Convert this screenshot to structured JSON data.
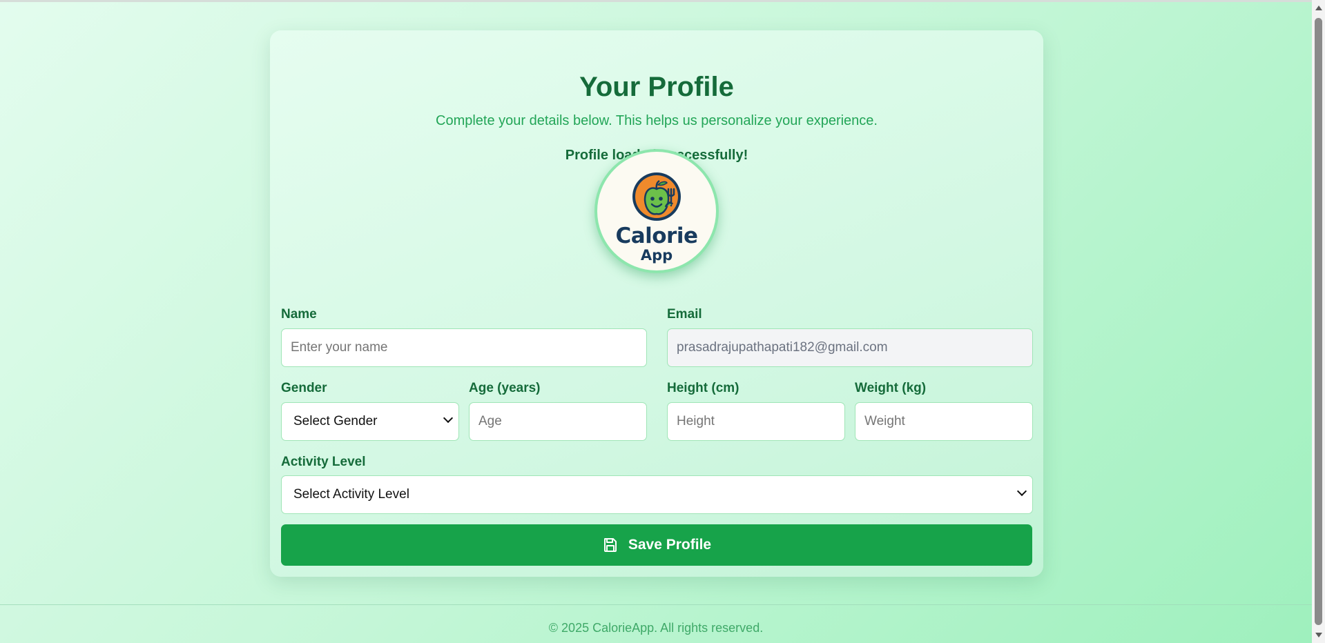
{
  "profile": {
    "title": "Your Profile",
    "subtitle": "Complete your details below. This helps us personalize your experience.",
    "status_message": "Profile loaded successfully!"
  },
  "logo": {
    "word1": "Calorie",
    "word2": "App",
    "icon": "apple-mascot-icon"
  },
  "form": {
    "name": {
      "label": "Name",
      "placeholder": "Enter your name",
      "value": ""
    },
    "email": {
      "label": "Email",
      "value": "prasadrajupathapati182@gmail.com"
    },
    "gender": {
      "label": "Gender",
      "selected": "Select Gender"
    },
    "age": {
      "label": "Age (years)",
      "placeholder": "Age"
    },
    "height": {
      "label": "Height (cm)",
      "placeholder": "Height"
    },
    "weight": {
      "label": "Weight (kg)",
      "placeholder": "Weight"
    },
    "activity": {
      "label": "Activity Level",
      "selected": "Select Activity Level"
    },
    "save_label": "Save Profile",
    "save_icon": "save-icon"
  },
  "footer": {
    "text": "© 2025 CalorieApp. All rights reserved."
  },
  "colors": {
    "primary": "#17a34a",
    "heading": "#156b3a",
    "accent_text": "#22a557",
    "logo_text": "#183b5e"
  }
}
